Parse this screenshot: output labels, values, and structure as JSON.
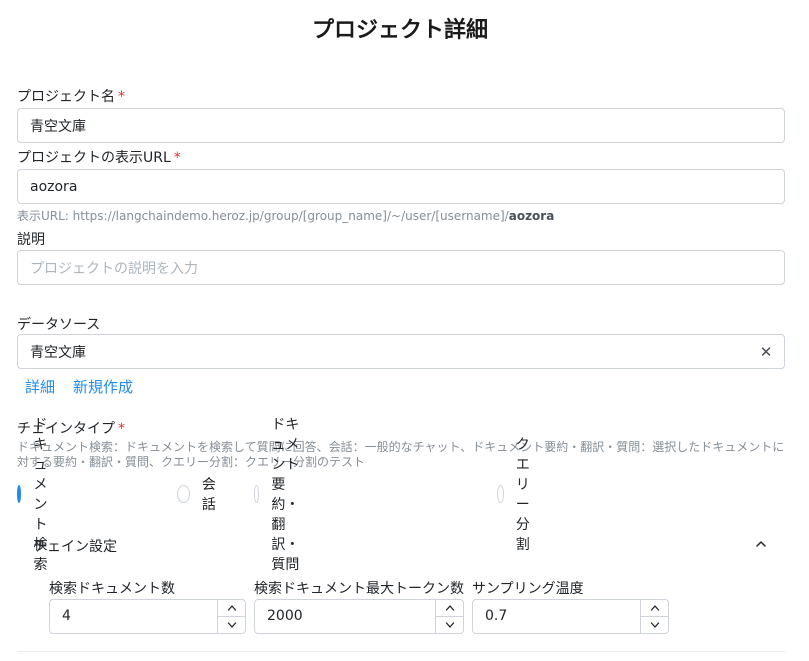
{
  "page": {
    "title": "プロジェクト詳細"
  },
  "form": {
    "name": {
      "label": "プロジェクト名",
      "required": "*",
      "value": "青空文庫"
    },
    "url": {
      "label": "プロジェクトの表示URL",
      "required": "*",
      "value": "aozora",
      "hint_prefix": "表示URL: https://langchaindemo.heroz.jp/group/[group_name]/~/user/[username]/",
      "hint_slug": "aozora"
    },
    "description": {
      "label": "説明",
      "placeholder": "プロジェクトの説明を入力"
    },
    "datasource": {
      "label": "データソース",
      "value": "青空文庫",
      "detail_link": "詳細",
      "new_link": "新規作成"
    },
    "chain_type": {
      "label": "チェインタイプ",
      "required": "*",
      "description_line1": "ドキュメント検索：ドキュメントを検索して質問に回答、会話：一般的なチャット、ドキュメント要約・翻訳・質問：選択したドキュメントに",
      "description_line2": "対する要約・翻訳・質問、クエリー分割：クエリー分割のテスト",
      "options": [
        {
          "label": "ドキュメント検索",
          "selected": true
        },
        {
          "label": "会話",
          "selected": false
        },
        {
          "label": "ドキュメント要約・翻訳・質問",
          "selected": false
        },
        {
          "label": "クエリー分割",
          "selected": false
        }
      ]
    },
    "chain_settings": {
      "title": "チェイン設定",
      "expanded": true,
      "fields": [
        {
          "label": "検索ドキュメント数",
          "value": "4"
        },
        {
          "label": "検索ドキュメント最大トークン数",
          "value": "2000"
        },
        {
          "label": "サンプリング温度",
          "value": "0.7"
        }
      ]
    }
  },
  "icons": {
    "clear": "close-icon",
    "collapse": "chevron-up-icon",
    "increment": "chevron-up-icon",
    "decrement": "chevron-down-icon"
  },
  "colors": {
    "accent": "#228be6",
    "required": "#e03131",
    "border": "#ced4da",
    "hint": "#868e96"
  }
}
